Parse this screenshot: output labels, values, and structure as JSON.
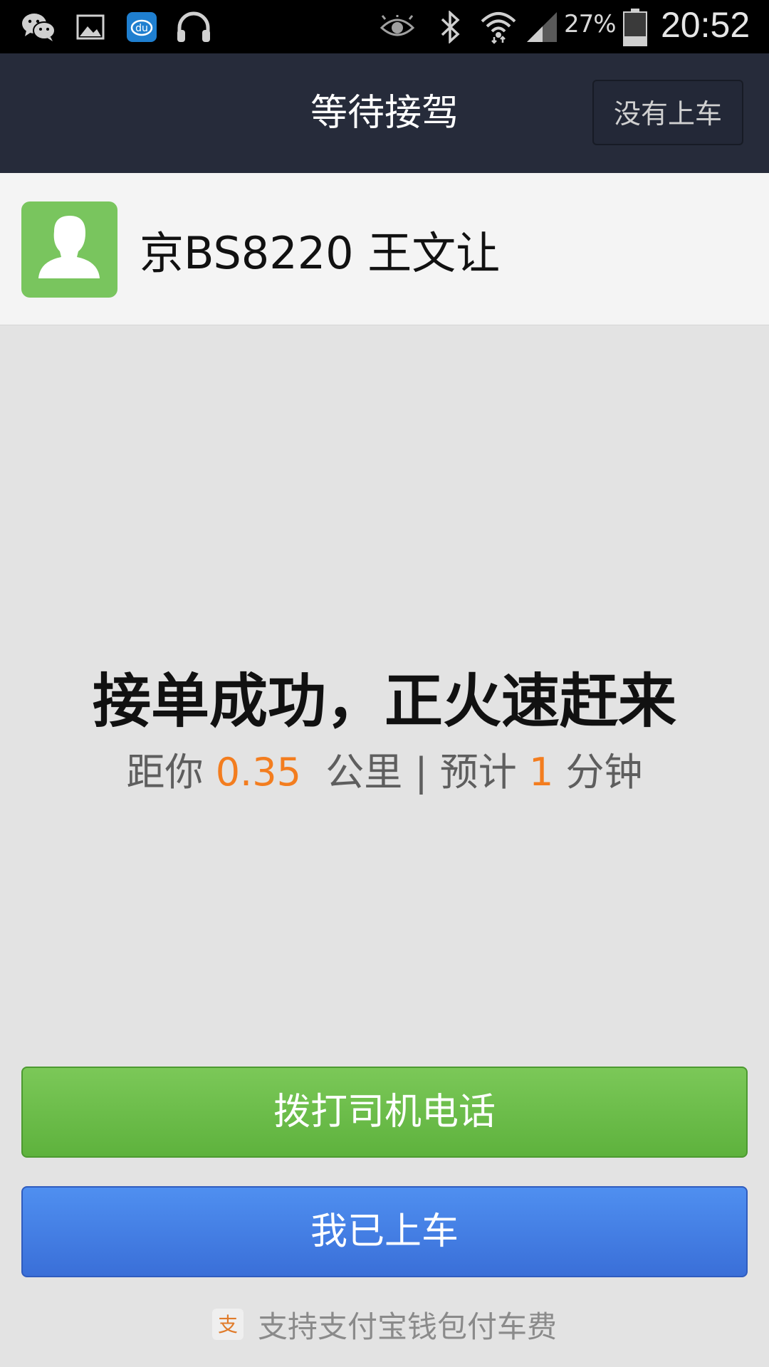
{
  "status_bar": {
    "icons_left": [
      "wechat-icon",
      "gallery-icon",
      "baidu-music-icon",
      "headphones-icon"
    ],
    "icons_right": [
      "eye-icon",
      "bluetooth-icon",
      "wifi-icon",
      "signal-icon",
      "battery-icon"
    ],
    "battery_percent": "27%",
    "time": "20:52"
  },
  "header": {
    "title": "等待接驾",
    "not_boarded_label": "没有上车"
  },
  "driver": {
    "avatar_icon": "driver-avatar-icon",
    "info": "京BS8220 王文让"
  },
  "main": {
    "status_title": "接单成功，正火速赶来",
    "eta": {
      "prefix": "距你 ",
      "distance": "0.35",
      "distance_unit": "  公里 | 预计 ",
      "minutes": "1",
      "minutes_unit": " 分钟"
    }
  },
  "actions": {
    "call_driver_label": "拨打司机电话",
    "boarded_label": "我已上车"
  },
  "footer": {
    "icon": "alipay-icon",
    "text": "支持支付宝钱包付车费"
  },
  "colors": {
    "nav_bg": "#262b3a",
    "accent_orange": "#f37d1f",
    "call_green": "#6bbd4a",
    "boarded_blue": "#4580e6",
    "avatar_green": "#79c55e"
  }
}
